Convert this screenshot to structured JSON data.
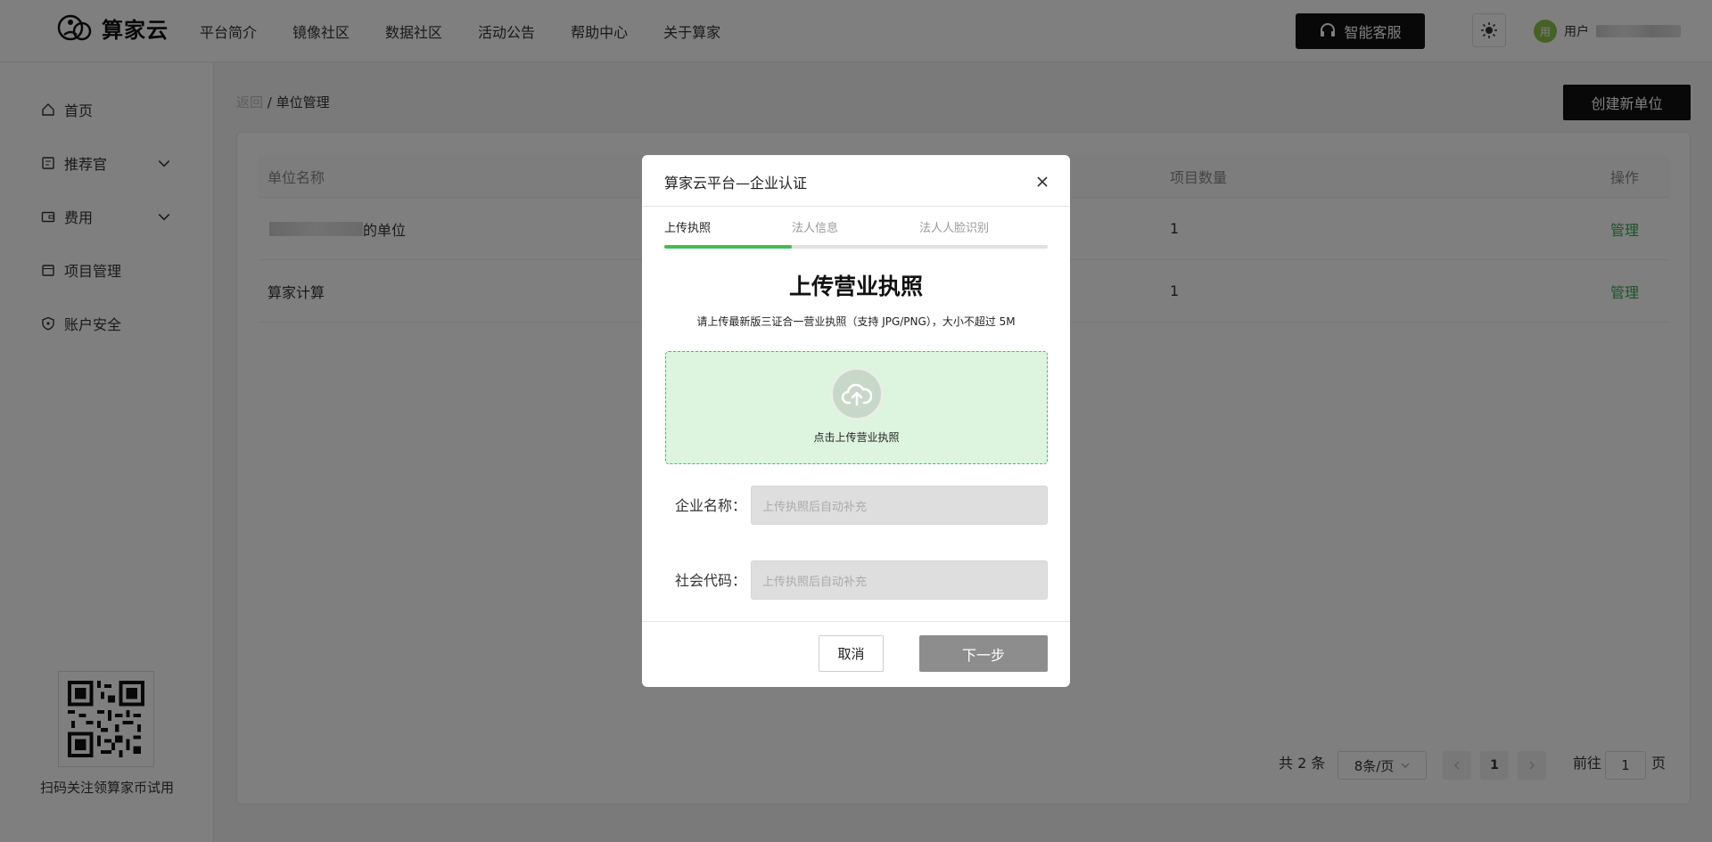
{
  "header": {
    "logo_text": "算家云",
    "nav": [
      "平台简介",
      "镜像社区",
      "数据社区",
      "活动公告",
      "帮助中心",
      "关于算家"
    ],
    "service_button": "智能客服",
    "avatar_initial": "用",
    "user_label": "用户"
  },
  "sidebar": {
    "items": [
      {
        "label": "首页",
        "icon": "home-icon"
      },
      {
        "label": "推荐官",
        "icon": "badge-icon",
        "expandable": true
      },
      {
        "label": "费用",
        "icon": "wallet-icon",
        "expandable": true
      },
      {
        "label": "项目管理",
        "icon": "folder-icon"
      },
      {
        "label": "账户安全",
        "icon": "shield-icon"
      }
    ],
    "qr_caption": "扫码关注领算家币试用"
  },
  "main": {
    "breadcrumb_back": "返回",
    "breadcrumb_sep": " / ",
    "breadcrumb_current": "单位管理",
    "create_button": "创建新单位",
    "table": {
      "columns": [
        "单位名称",
        "项目数量",
        "操作"
      ],
      "rows": [
        {
          "name_suffix": "的单位",
          "count": "1",
          "action": "管理"
        },
        {
          "name": "算家计算",
          "count": "1",
          "action": "管理"
        }
      ]
    },
    "pagination": {
      "total": "共 2 条",
      "page_size": "8条/页",
      "current_page": "1",
      "goto_label": "前往",
      "goto_value": "1",
      "page_unit": "页"
    }
  },
  "modal": {
    "title": "算家云平台—企业认证",
    "steps": [
      "上传执照",
      "法人信息",
      "法人人脸识别"
    ],
    "active_step": 0,
    "progress_fraction": 0.333,
    "heading": "上传营业执照",
    "subtitle": "请上传最新版三证合一营业执照（支持 JPG/PNG），大小不超过 5M",
    "upload_text": "点击上传营业执照",
    "fields": [
      {
        "label": "企业名称：",
        "placeholder": "上传执照后自动补充"
      },
      {
        "label": "社会代码：",
        "placeholder": "上传执照后自动补充"
      }
    ],
    "cancel_button": "取消",
    "next_button": "下一步"
  },
  "colors": {
    "accent_green": "#3dbe52",
    "dark": "#111111"
  }
}
